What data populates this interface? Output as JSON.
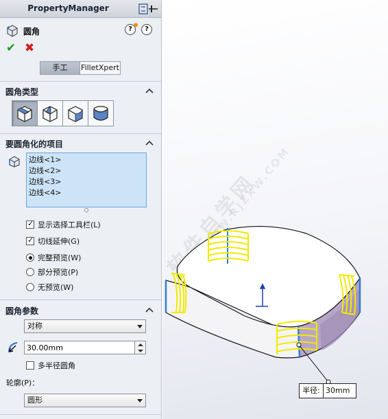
{
  "header": {
    "title": "PropertyManager"
  },
  "feature": {
    "name": "圆角"
  },
  "modes": {
    "manual": "手工",
    "filletxpert": "FilletXpert"
  },
  "fillet_type_group": {
    "title": "圆角类型"
  },
  "items_group": {
    "title": "要圆角化的项目",
    "items": [
      "边线<1>",
      "边线<2>",
      "边线<3>",
      "边线<4>"
    ],
    "show_selection_toolbar": "显示选择工具栏(L)",
    "tangent_propagation": "切线延伸(G)",
    "preview_full": "完整预览(W)",
    "preview_partial": "部分预览(P)",
    "preview_none": "无预览(W)"
  },
  "params_group": {
    "title": "圆角参数",
    "method": "对称",
    "radius": "30.00mm",
    "multi_radius": "多半径圆角",
    "profile_label": "轮廓(P)：",
    "profile": "圆形"
  },
  "callout": {
    "label": "半径:",
    "value": "30mm"
  },
  "watermark": {
    "text": "软件自学网",
    "url": "WWW.RJZXW.COM"
  },
  "colors": {
    "highlight": "#f2ea00",
    "selection": "#cde4f8",
    "ok": "#1e9b1e",
    "cancel": "#d21f1f"
  }
}
